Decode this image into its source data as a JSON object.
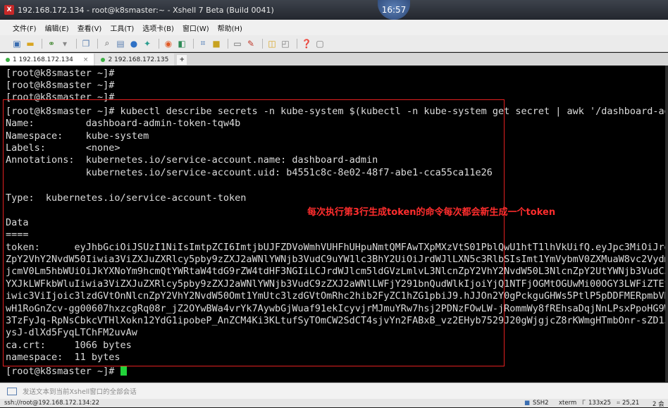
{
  "window": {
    "title": "192.168.172.134 - root@k8smaster:~ - Xshell 7 Beta (Build 0041)",
    "clock": "16:57"
  },
  "menu": {
    "items": [
      "文件(F)",
      "编辑(E)",
      "查看(V)",
      "工具(T)",
      "选项卡(B)",
      "窗口(W)",
      "帮助(H)"
    ]
  },
  "toolbar": {
    "icons": [
      "new-session-icon",
      "folder-icon",
      "link-icon",
      "disconnect-icon",
      "copy-icon",
      "search-icon",
      "font-icon",
      "color-icon",
      "palette-icon",
      "compose-icon",
      "record-icon",
      "transfer-icon",
      "lock-icon",
      "keyboard-icon",
      "script-icon",
      "layout-icon",
      "window-icon",
      "help-icon",
      "chat-icon"
    ]
  },
  "tabs": [
    {
      "label": "1 192.168.172.134",
      "close": "×"
    },
    {
      "label": "2 192.168.172.135"
    }
  ],
  "tab_add": "+",
  "terminal": {
    "lines": [
      "[root@k8smaster ~]#",
      "[root@k8smaster ~]#",
      "[root@k8smaster ~]#",
      "[root@k8smaster ~]# kubectl describe secrets -n kube-system $(kubectl -n kube-system get secret | awk '/dashboard-admin/{p",
      "Name:         dashboard-admin-token-tqw4b",
      "Namespace:    kube-system",
      "Labels:       <none>",
      "Annotations:  kubernetes.io/service-account.name: dashboard-admin",
      "              kubernetes.io/service-account.uid: b4551c8c-8e02-48f7-abe1-cca55ca11e26",
      "",
      "Type:  kubernetes.io/service-account-token",
      "",
      "Data",
      "====",
      "token:      eyJhbGciOiJSUzI1NiIsImtpZCI6ImtjbUJFZDVoWmhVUHFhUHpuNmtQMFAwTXpMXzVtS01PblQwU1htT1lhVkUifQ.eyJpc3MiOiJrdWJlcm5",
      "ZpY2VhY2NvdW50Iiwia3ViZXJuZXRlcy5pby9zZXJ2aWNlYWNjb3VudC9uYW1lc3BhY2UiOiJrdWJlLXN5c3RlbSIsImt1YmVybmV0ZXMuaW8vc2VydmljZWFj",
      "jcmV0Lm5hbWUiOiJkYXNoYm9hcmQtYWRtaW4tdG9rZW4tdHF3NGIiLCJrdWJlcm5ldGVzLmlvL3NlcnZpY2VhY2NvdW50L3NlcnZpY2UtYWNjb3VudC5uYW1lI",
      "YXJkLWFkbWluIiwia3ViZXJuZXRlcy5pby9zZXJ2aWNlYWNjb3VudC9zZXJ2aWNlLWFjY291bnQudWlkIjoiYjQ1NTFjOGMtOGUwMi00OGY3LWFiZTEtY2NhNT",
      "iwic3ViIjoic3lzdGVtOnNlcnZpY2VhY2NvdW50Omt1YmUtc3lzdGVtOmRhc2hib2FyZC1hZG1pbiJ9.hJJOn2Y0gPckguGHWs5PtlP5pDDFMERpmbVHrd9isd",
      "wH1RoGnZcv-gg00607hxzcgRq08r_jZ2OYwBWa4vrYk7AywbGjWuaf91ekIcyvjrMJmuYRw7hsj2PDNzFOwLW-jRommWy8fREhsaDqjNnLPsxPpoHG9W4con9c",
      "3TzFyJq-RpNsCbkcVTHlXokn12YdG1ipobeP_AnZCM4Ki3KLtufSyTOmCW2SdCT4sjvYn2FABxB_vz2EHyb7529J20gWjgjcZ8rKWmgHTmbOnr-sZD15kPSCwl",
      "ysJ-dlXd5FyqLTChFM2uvAw",
      "ca.crt:     1066 bytes",
      "namespace:  11 bytes",
      "[root@k8smaster ~]# "
    ],
    "annotation": "每次执行第3行生成token的命令每次都会新生成一个token"
  },
  "input_bar": {
    "placeholder": "发送文本到当前Xshell窗口的全部会话"
  },
  "status": {
    "connection": "ssh://root@192.168.172.134:22",
    "protocol": "SSH2",
    "terminal": "xterm",
    "size": "133x25",
    "position": "25,21",
    "sessions": "2 会"
  },
  "colors": {
    "annotation": "#ff2d2d",
    "cursor": "#22d33a",
    "terminal_bg": "#000000"
  }
}
